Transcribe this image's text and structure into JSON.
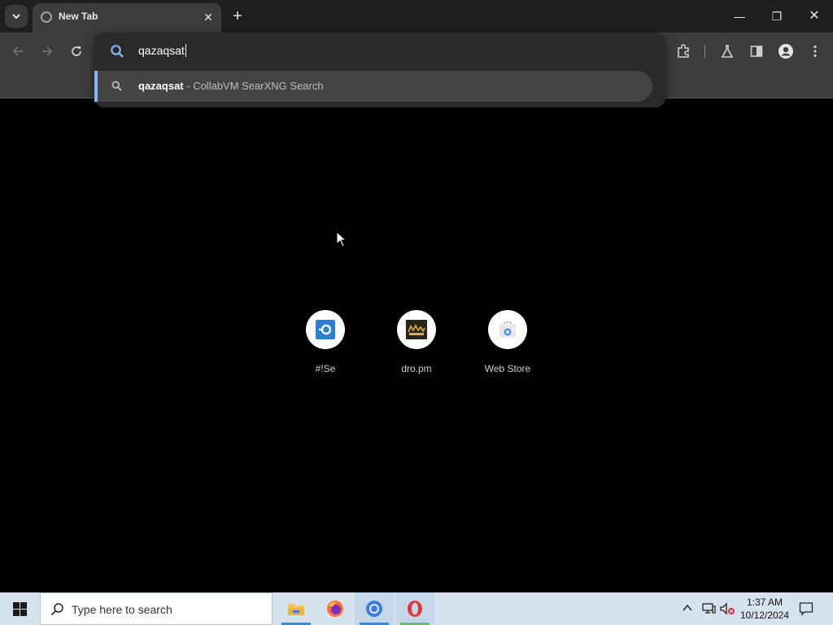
{
  "browser": {
    "tab": {
      "title": "New Tab"
    },
    "omnibox": {
      "value": "qazaqsat",
      "suggestion_query": "qazaqsat",
      "suggestion_rest": " - CollabVM SearXNG Search"
    },
    "accent": "#8ab4f8"
  },
  "shortcuts": [
    {
      "label": "#!Se",
      "icon": "searx-icon"
    },
    {
      "label": "dro.pm",
      "icon": "dro-pm-icon"
    },
    {
      "label": "Web Store",
      "icon": "web-store-icon"
    }
  ],
  "taskbar": {
    "search_placeholder": "Type here to search",
    "time": "1:37 AM",
    "date": "10/12/2024"
  }
}
